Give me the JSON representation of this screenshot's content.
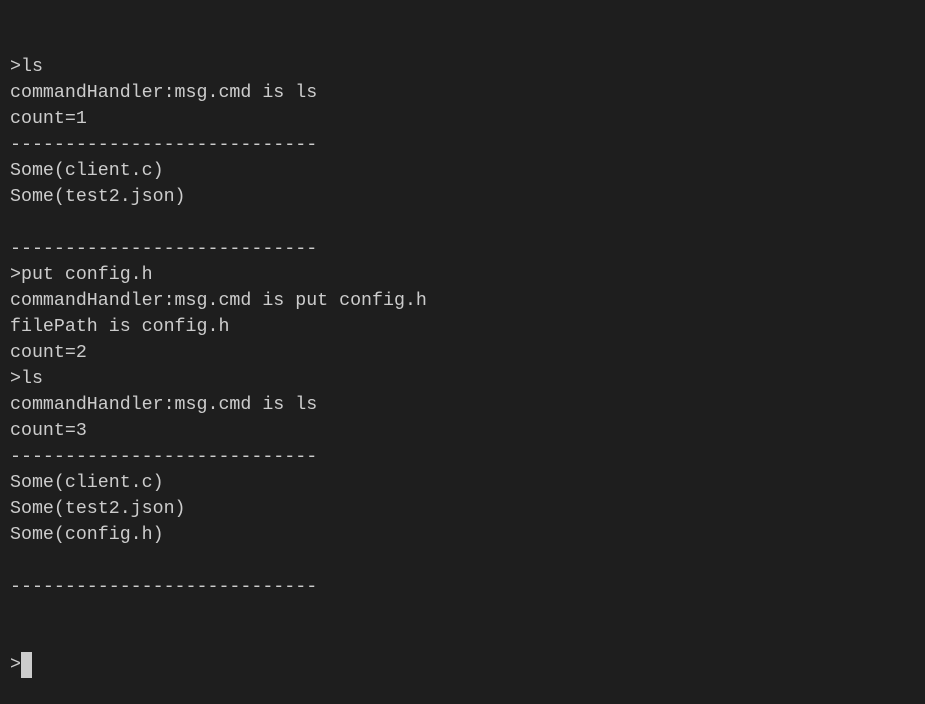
{
  "terminal": {
    "lines": [
      ">ls",
      "commandHandler:msg.cmd is ls",
      "count=1",
      "----------------------------",
      "Some(client.c)",
      "Some(test2.json)",
      "",
      "----------------------------",
      ">put config.h",
      "commandHandler:msg.cmd is put config.h",
      "filePath is config.h",
      "count=2",
      ">ls",
      "commandHandler:msg.cmd is ls",
      "count=3",
      "----------------------------",
      "Some(client.c)",
      "Some(test2.json)",
      "Some(config.h)",
      "",
      "----------------------------"
    ],
    "prompt": ">",
    "colors": {
      "background": "#1e1e1e",
      "text": "#cccccc"
    }
  }
}
